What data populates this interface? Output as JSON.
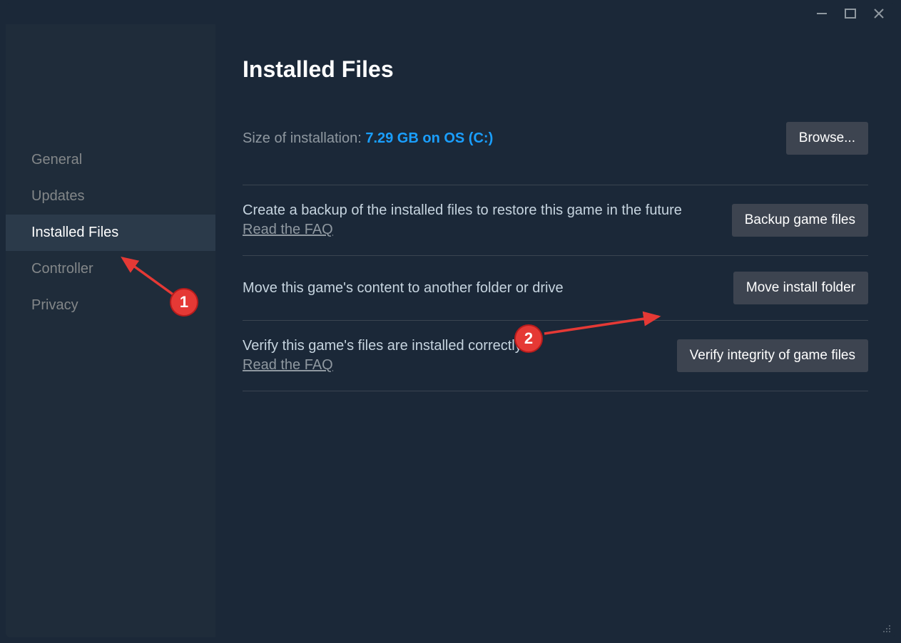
{
  "sidebar": {
    "items": [
      {
        "label": "General"
      },
      {
        "label": "Updates"
      },
      {
        "label": "Installed Files"
      },
      {
        "label": "Controller"
      },
      {
        "label": "Privacy"
      }
    ]
  },
  "header": {
    "title": "Installed Files"
  },
  "install_size": {
    "label": "Size of installation: ",
    "value": "7.29 GB on OS (C:)",
    "browse": "Browse..."
  },
  "rows": {
    "backup": {
      "desc": "Create a backup of the installed files to restore this game in the future",
      "faq": "Read the FAQ",
      "button": "Backup game files"
    },
    "move": {
      "desc": "Move this game's content to another folder or drive",
      "button": "Move install folder"
    },
    "verify": {
      "desc": "Verify this game's files are installed correctly",
      "faq": "Read the FAQ",
      "button": "Verify integrity of game files"
    }
  },
  "annotations": {
    "one": "1",
    "two": "2"
  }
}
